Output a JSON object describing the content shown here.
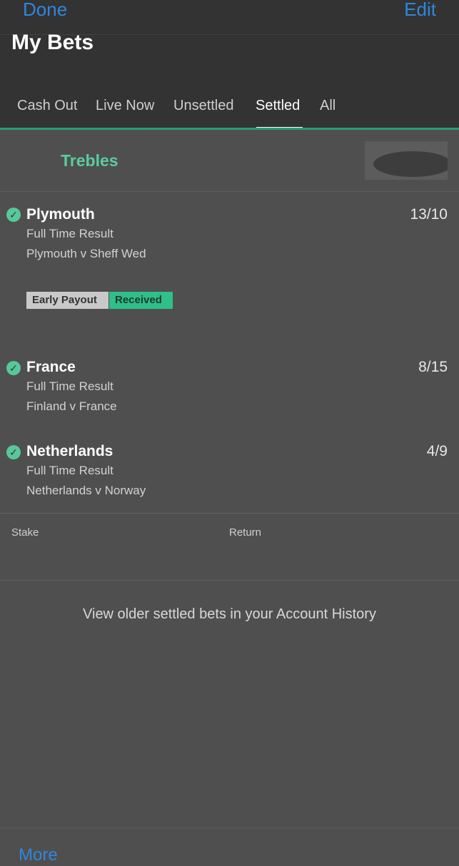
{
  "navbar": {
    "done_label": "Done",
    "edit_label": "Edit"
  },
  "page_title": "My Bets",
  "tabs": [
    {
      "label": "Cash Out",
      "active": false
    },
    {
      "label": "Live Now",
      "active": false
    },
    {
      "label": "Unsettled",
      "active": false
    },
    {
      "label": "Settled",
      "active": true
    },
    {
      "label": "All",
      "active": false
    }
  ],
  "bet": {
    "type": "Trebles",
    "selections": [
      {
        "name": "Plymouth",
        "market": "Full Time Result",
        "event": "Plymouth v Sheff Wed",
        "odds": "13/10",
        "badges": [
          "Early Payout",
          "Received"
        ]
      },
      {
        "name": "France",
        "market": "Full Time Result",
        "event": "Finland v France",
        "odds": "8/15"
      },
      {
        "name": "Netherlands",
        "market": "Full Time Result",
        "event": "Netherlands v Norway",
        "odds": "4/9"
      }
    ],
    "stake_label": "Stake",
    "return_label": "Return"
  },
  "history_text": "View older settled bets in your Account History",
  "more_label": "More",
  "icons": {
    "status": "check-circle-icon"
  },
  "colors": {
    "accent": "#2f86de",
    "success": "#58c79a",
    "bet_type": "#5ccba0",
    "tab_indicator": "#1fa27a"
  }
}
